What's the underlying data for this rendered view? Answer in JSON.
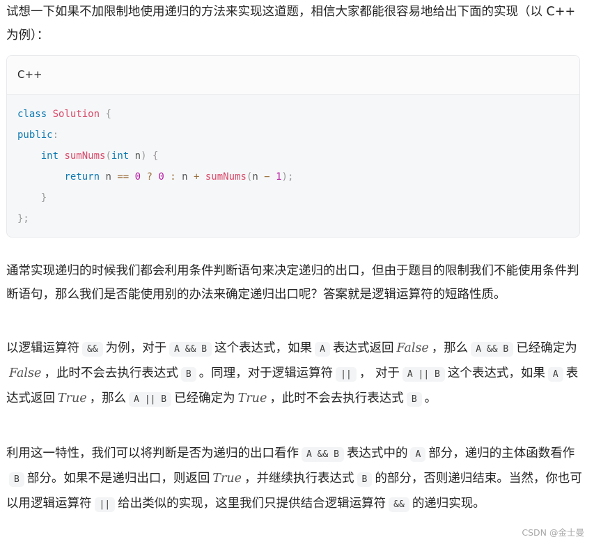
{
  "intro": "试想一下如果不加限制地使用递归的方法来实现这道题，相信大家都能很容易地给出下面的实现（以 C++ 为例）：",
  "code": {
    "language": "C++",
    "l1": {
      "kw": "class",
      "cls": "Solution",
      "brace": "{"
    },
    "l2": {
      "kw": "public",
      "colon": ":"
    },
    "l3": {
      "kw": "int",
      "fn": "sumNums",
      "lp": "(",
      "kw2": "int",
      "var": "n",
      "rp": ")",
      "brace": "{"
    },
    "l4": {
      "kw": "return",
      "v1": "n",
      "op1": "==",
      "n1": "0",
      "q": "?",
      "n2": "0",
      "c": ":",
      "v2": "n",
      "op2": "+",
      "fn": "sumNums",
      "lp": "(",
      "v3": "n",
      "op3": "−",
      "n3": "1",
      "rp": ")",
      "semi": ";"
    },
    "l5": "}",
    "l6": "};"
  },
  "p1": "通常实现递归的时候我们都会利用条件判断语句来决定递归的出口，但由于题目的限制我们不能使用条件判断语句，那么我们是否能使用别的办法来确定递归出口呢？答案就是逻辑运算符的短路性质。",
  "p2": {
    "t1": "以逻辑运算符",
    "c1": "&&",
    "t2": "为例，对于",
    "c2": "A && B",
    "t3": "这个表达式，如果",
    "c3": "A",
    "t4": "表达式返回",
    "m1": "False",
    "t5": "，那么",
    "c4": "A && B",
    "t6": "已经确定为",
    "m2": "False",
    "t7": "，此时不会去执行表达式",
    "c5": "B",
    "t8": "。同理，对于逻辑运算符",
    "c6": "||",
    "t9": "， 对于",
    "c7": "A || B",
    "t10": "这个表达式，如果",
    "c8": "A",
    "t11": "表达式返回",
    "m3": "True",
    "t12": "，那么",
    "c9": "A || B",
    "t13": "已经确定为",
    "m4": "True",
    "t14": "，此时不会去执行表达式",
    "c10": "B",
    "t15": "。"
  },
  "p3": {
    "t1": "利用这一特性，我们可以将判断是否为递归的出口看作",
    "c1": "A && B",
    "t2": "表达式中的",
    "c2": "A",
    "t3": "部分，递归的主体函数看作",
    "c3": "B",
    "t4": "部分。如果不是递归出口，则返回",
    "m1": "True",
    "t5": "，并继续执行表达式",
    "c4": "B",
    "t6": "的部分，否则递归结束。当然，你也可以用逻辑运算符",
    "c5": "||",
    "t7": "给出类似的实现，这里我们只提供结合逻辑运算符",
    "c6": "&&",
    "t8": "的递归实现。"
  },
  "watermark": "CSDN @金士曼"
}
